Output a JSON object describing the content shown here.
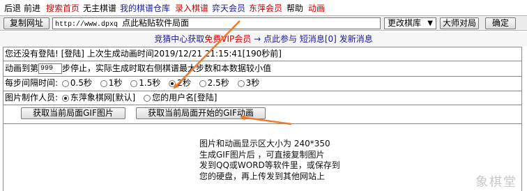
{
  "nav": {
    "items": [
      {
        "label": "后退",
        "color": "#000000"
      },
      {
        "label": "前进",
        "color": "#000000"
      },
      {
        "label": "搜索首页",
        "color": "#cc0000"
      },
      {
        "label": "无主棋谱",
        "color": "#000000"
      },
      {
        "label": "我的棋谱仓库",
        "color": "#1a1aa0"
      },
      {
        "label": "录入棋谱",
        "color": "#cc0000"
      },
      {
        "label": "弈天会员",
        "color": "#1a1aa0"
      },
      {
        "label": "东萍会员",
        "color": "#cc0000"
      },
      {
        "label": "帮助",
        "color": "#000000"
      },
      {
        "label": "动画",
        "color": "#cc0000"
      }
    ]
  },
  "url_bar": {
    "copy_button": "复制网址",
    "url_value": "http://www.dpxq",
    "url_hint": "点此粘贴软件局面",
    "select_value": "更改棋库",
    "master_button": "大师对局",
    "ok_button": "确定"
  },
  "banner": {
    "part1": "竞猜中心获取",
    "part2": "免费VIP会员",
    "arrow": "→",
    "part3": "点此参与",
    "part4": "短消息[0]",
    "part5": "发新消息"
  },
  "status": {
    "text": "您还没有登陆! [登陆] 上次生成动画时间2019/12/21 21:15:41[190秒前]"
  },
  "anim": {
    "prefix": "动画到第",
    "value": "999",
    "suffix": "步停止，实际生成时取右侧棋谱最大步数和本数据较小值"
  },
  "interval": {
    "label": "每步间隔时间:",
    "options": [
      "0.5秒",
      "1秒",
      "1.5秒",
      "2秒",
      "2.5秒",
      "3秒"
    ],
    "selected": "2秒"
  },
  "maker": {
    "label": "图片制作人员:",
    "options": [
      "东萍象棋网[默认]",
      "您的用户名[登陆]"
    ],
    "selected": "东萍象棋网[默认]"
  },
  "gif": {
    "image_button": "获取当前局面GIF图片",
    "anim_button": "获取当前局面开始的GIF动画"
  },
  "note": {
    "lines": [
      "图片和动画显示区大小为 240*350",
      "生成GIF图片后 ，可直接复制图片",
      "发到QQ或WORD等软件里，或保存到",
      "您的硬盘，再上传发到其他网站上"
    ]
  },
  "watermark": "象棋堂",
  "colors": {
    "arrow": "#f07a2a",
    "link_red": "#cc0000",
    "link_blue": "#1a1aa0"
  }
}
